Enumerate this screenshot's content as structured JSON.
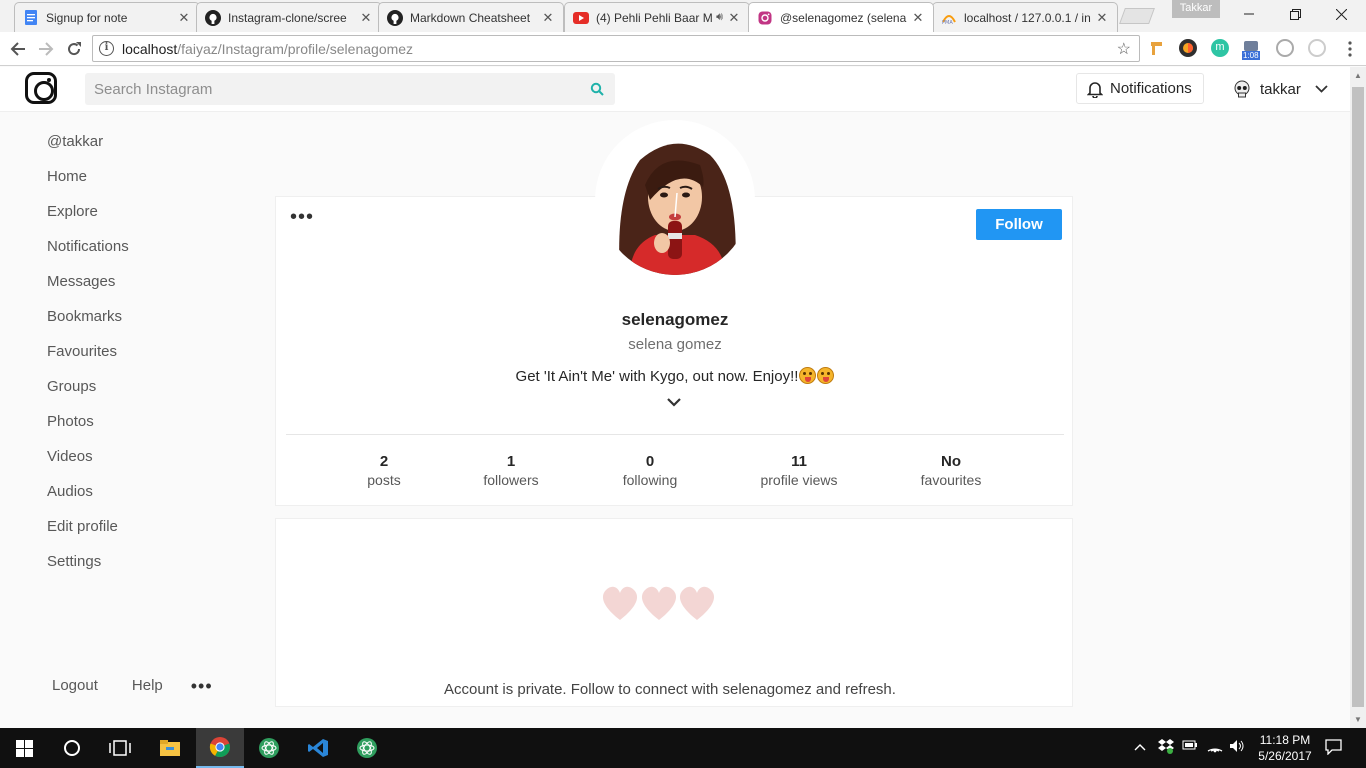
{
  "browser": {
    "tabs": [
      {
        "title": "Signup for note",
        "icon": "doc-icon",
        "active": false
      },
      {
        "title": "Instagram-clone/scree",
        "icon": "github-icon",
        "active": false
      },
      {
        "title": "Markdown Cheatsheet",
        "icon": "github-icon",
        "active": false
      },
      {
        "title": "(4) Pehli Pehli Baar M",
        "icon": "youtube-icon",
        "active": false
      },
      {
        "title": "@selenagomez (selena",
        "icon": "instagram-icon",
        "active": true
      },
      {
        "title": "localhost / 127.0.0.1 / in",
        "icon": "phpmyadmin-icon",
        "active": false
      }
    ],
    "profile_name": "Takkar",
    "address_host": "localhost",
    "address_path": "/faiyaz/Instagram/profile/selenagomez",
    "extension_badge": "1:08"
  },
  "header": {
    "search_placeholder": "Search Instagram",
    "notifications_label": "Notifications",
    "username": "takkar"
  },
  "sidebar": {
    "items": [
      {
        "label": "@takkar"
      },
      {
        "label": "Home"
      },
      {
        "label": "Explore"
      },
      {
        "label": "Notifications"
      },
      {
        "label": "Messages"
      },
      {
        "label": "Bookmarks"
      },
      {
        "label": "Favourites"
      },
      {
        "label": "Groups"
      },
      {
        "label": "Photos"
      },
      {
        "label": "Videos"
      },
      {
        "label": "Audios"
      },
      {
        "label": "Edit profile"
      },
      {
        "label": "Settings"
      }
    ],
    "footer": {
      "logout": "Logout",
      "help": "Help",
      "more": "•••"
    }
  },
  "profile": {
    "more_label": "•••",
    "follow_label": "Follow",
    "username": "selenagomez",
    "full_name": "selena gomez",
    "bio": "Get 'It Ain't Me' with Kygo, out now. Enjoy!!",
    "stats": [
      {
        "value": "2",
        "label": "posts"
      },
      {
        "value": "1",
        "label": "followers"
      },
      {
        "value": "0",
        "label": "following"
      },
      {
        "value": "11",
        "label": "profile views"
      },
      {
        "value": "No",
        "label": "favourites"
      }
    ],
    "private_message": "Account is private. Follow to connect with selenagomez and refresh."
  },
  "taskbar": {
    "time": "11:18 PM",
    "date": "5/26/2017"
  },
  "colors": {
    "follow_button": "#2196f3",
    "search_icon": "#20b2aa",
    "hearts": "#f3d6d4"
  }
}
